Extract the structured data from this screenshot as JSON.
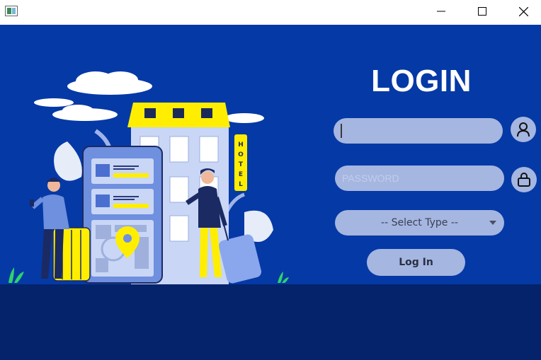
{
  "window": {
    "buttons": {
      "minimize_icon": "minimize-icon",
      "maximize_icon": "maximize-icon",
      "close_icon": "close-icon"
    }
  },
  "login": {
    "title": "LOGIN",
    "username": {
      "value": "",
      "placeholder": ""
    },
    "password": {
      "value": "",
      "placeholder": "PASSWORD"
    },
    "user_type": {
      "selected": "-- Select Type --"
    },
    "submit_label": "Log In"
  },
  "illustration": {
    "hotel_sign": [
      "H",
      "O",
      "T",
      "E",
      "L"
    ]
  },
  "colors": {
    "background": "#0539a6",
    "ground": "#04236b",
    "field": "#a5b6e0",
    "accent_yellow": "#ffee00"
  }
}
